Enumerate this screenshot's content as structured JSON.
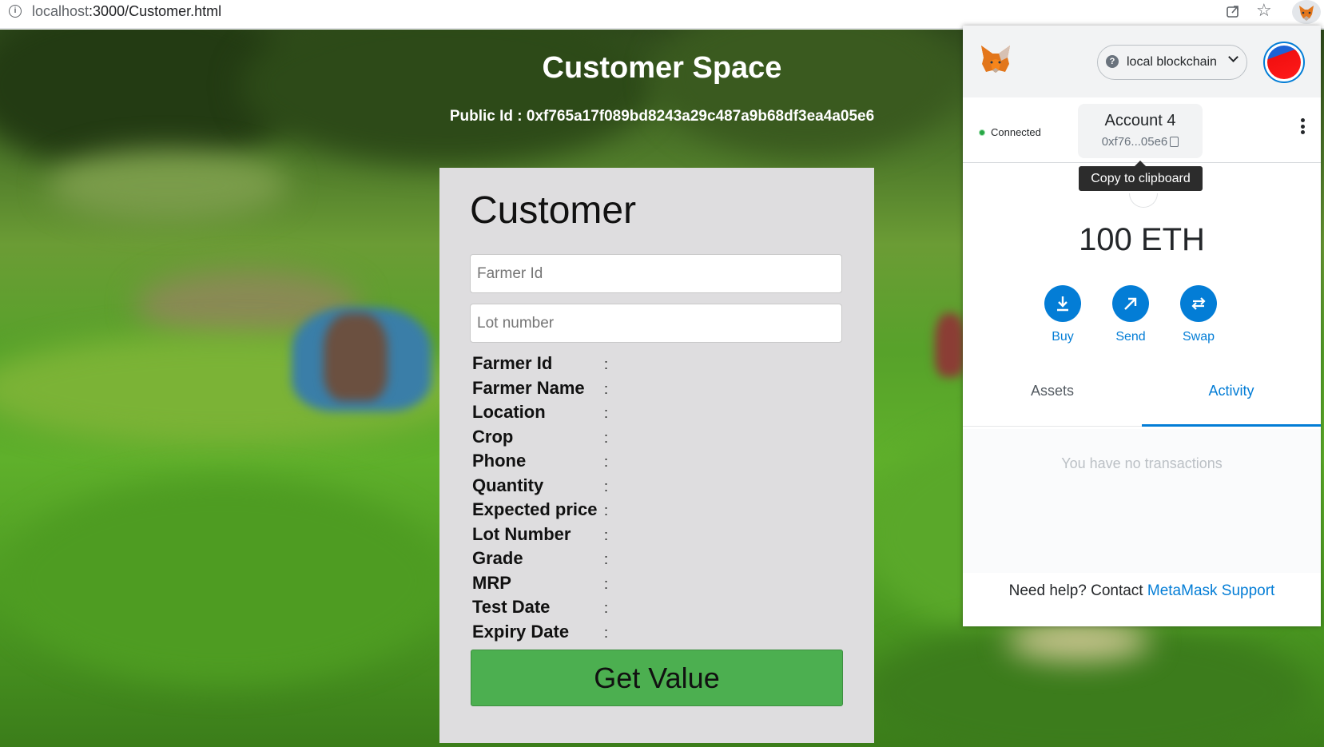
{
  "browser": {
    "url_host": "localhost",
    "url_path": ":3000/Customer.html"
  },
  "page": {
    "title": "Customer Space",
    "public_id": "Public Id : 0xf765a17f089bd8243a29c487a9b68df3ea4a05e6"
  },
  "customer_card": {
    "heading": "Customer",
    "farmer_id_placeholder": "Farmer Id",
    "lot_number_placeholder": "Lot number",
    "fields": [
      {
        "label": "Farmer Id",
        "colon": ":"
      },
      {
        "label": "Farmer Name",
        "colon": ":"
      },
      {
        "label": "Location",
        "colon": ":"
      },
      {
        "label": "Crop",
        "colon": ":"
      },
      {
        "label": "Phone",
        "colon": ":"
      },
      {
        "label": "Quantity",
        "colon": ":"
      },
      {
        "label": "Expected price",
        "colon": ":"
      },
      {
        "label": "Lot Number",
        "colon": ":"
      },
      {
        "label": "Grade",
        "colon": ":"
      },
      {
        "label": "MRP",
        "colon": ":"
      },
      {
        "label": "Test Date",
        "colon": ":"
      },
      {
        "label": "Expiry Date",
        "colon": ":"
      }
    ],
    "button_label": "Get Value"
  },
  "metamask": {
    "network": "local blockchain",
    "connection_status": "Connected",
    "account_name": "Account 4",
    "account_address": "0xf76...05e6",
    "tooltip": "Copy to clipboard",
    "balance": "100 ETH",
    "actions": [
      {
        "label": "Buy",
        "icon": "download-arrow-icon"
      },
      {
        "label": "Send",
        "icon": "diagonal-arrow-icon"
      },
      {
        "label": "Swap",
        "icon": "swap-arrows-icon"
      }
    ],
    "tabs": {
      "assets": "Assets",
      "activity": "Activity"
    },
    "empty_state": "You have no transactions",
    "help_text": "Need help? Contact",
    "help_link": "MetaMask Support",
    "colors": {
      "accent": "#037dd6",
      "connected": "#28a745"
    }
  },
  "colors": {
    "button_green": "#4caf50",
    "card_bg": "#dedddf"
  }
}
